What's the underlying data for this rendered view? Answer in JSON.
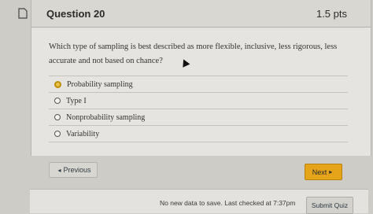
{
  "question": {
    "title": "Question 20",
    "points": "1.5 pts",
    "text": "Which type of sampling is best described as more flexible, inclusive, less rigorous, less accurate and not based on chance?",
    "choices": [
      {
        "label": "Probability sampling",
        "selected": true
      },
      {
        "label": "Type I",
        "selected": false
      },
      {
        "label": "Nonprobability sampling",
        "selected": false
      },
      {
        "label": "Variability",
        "selected": false
      }
    ]
  },
  "nav": {
    "previous_label": "Previous",
    "next_label": "Next"
  },
  "footer": {
    "status": "No new data to save. Last checked at 7:37pm",
    "submit_label": "Submit Quiz"
  },
  "colors": {
    "accent": "#e6a41a",
    "selected_radio": "#e9c64a"
  },
  "icons": {
    "bookmark": "bookmark-icon",
    "prev_arrow": "triangle-left",
    "next_arrow": "triangle-right"
  }
}
